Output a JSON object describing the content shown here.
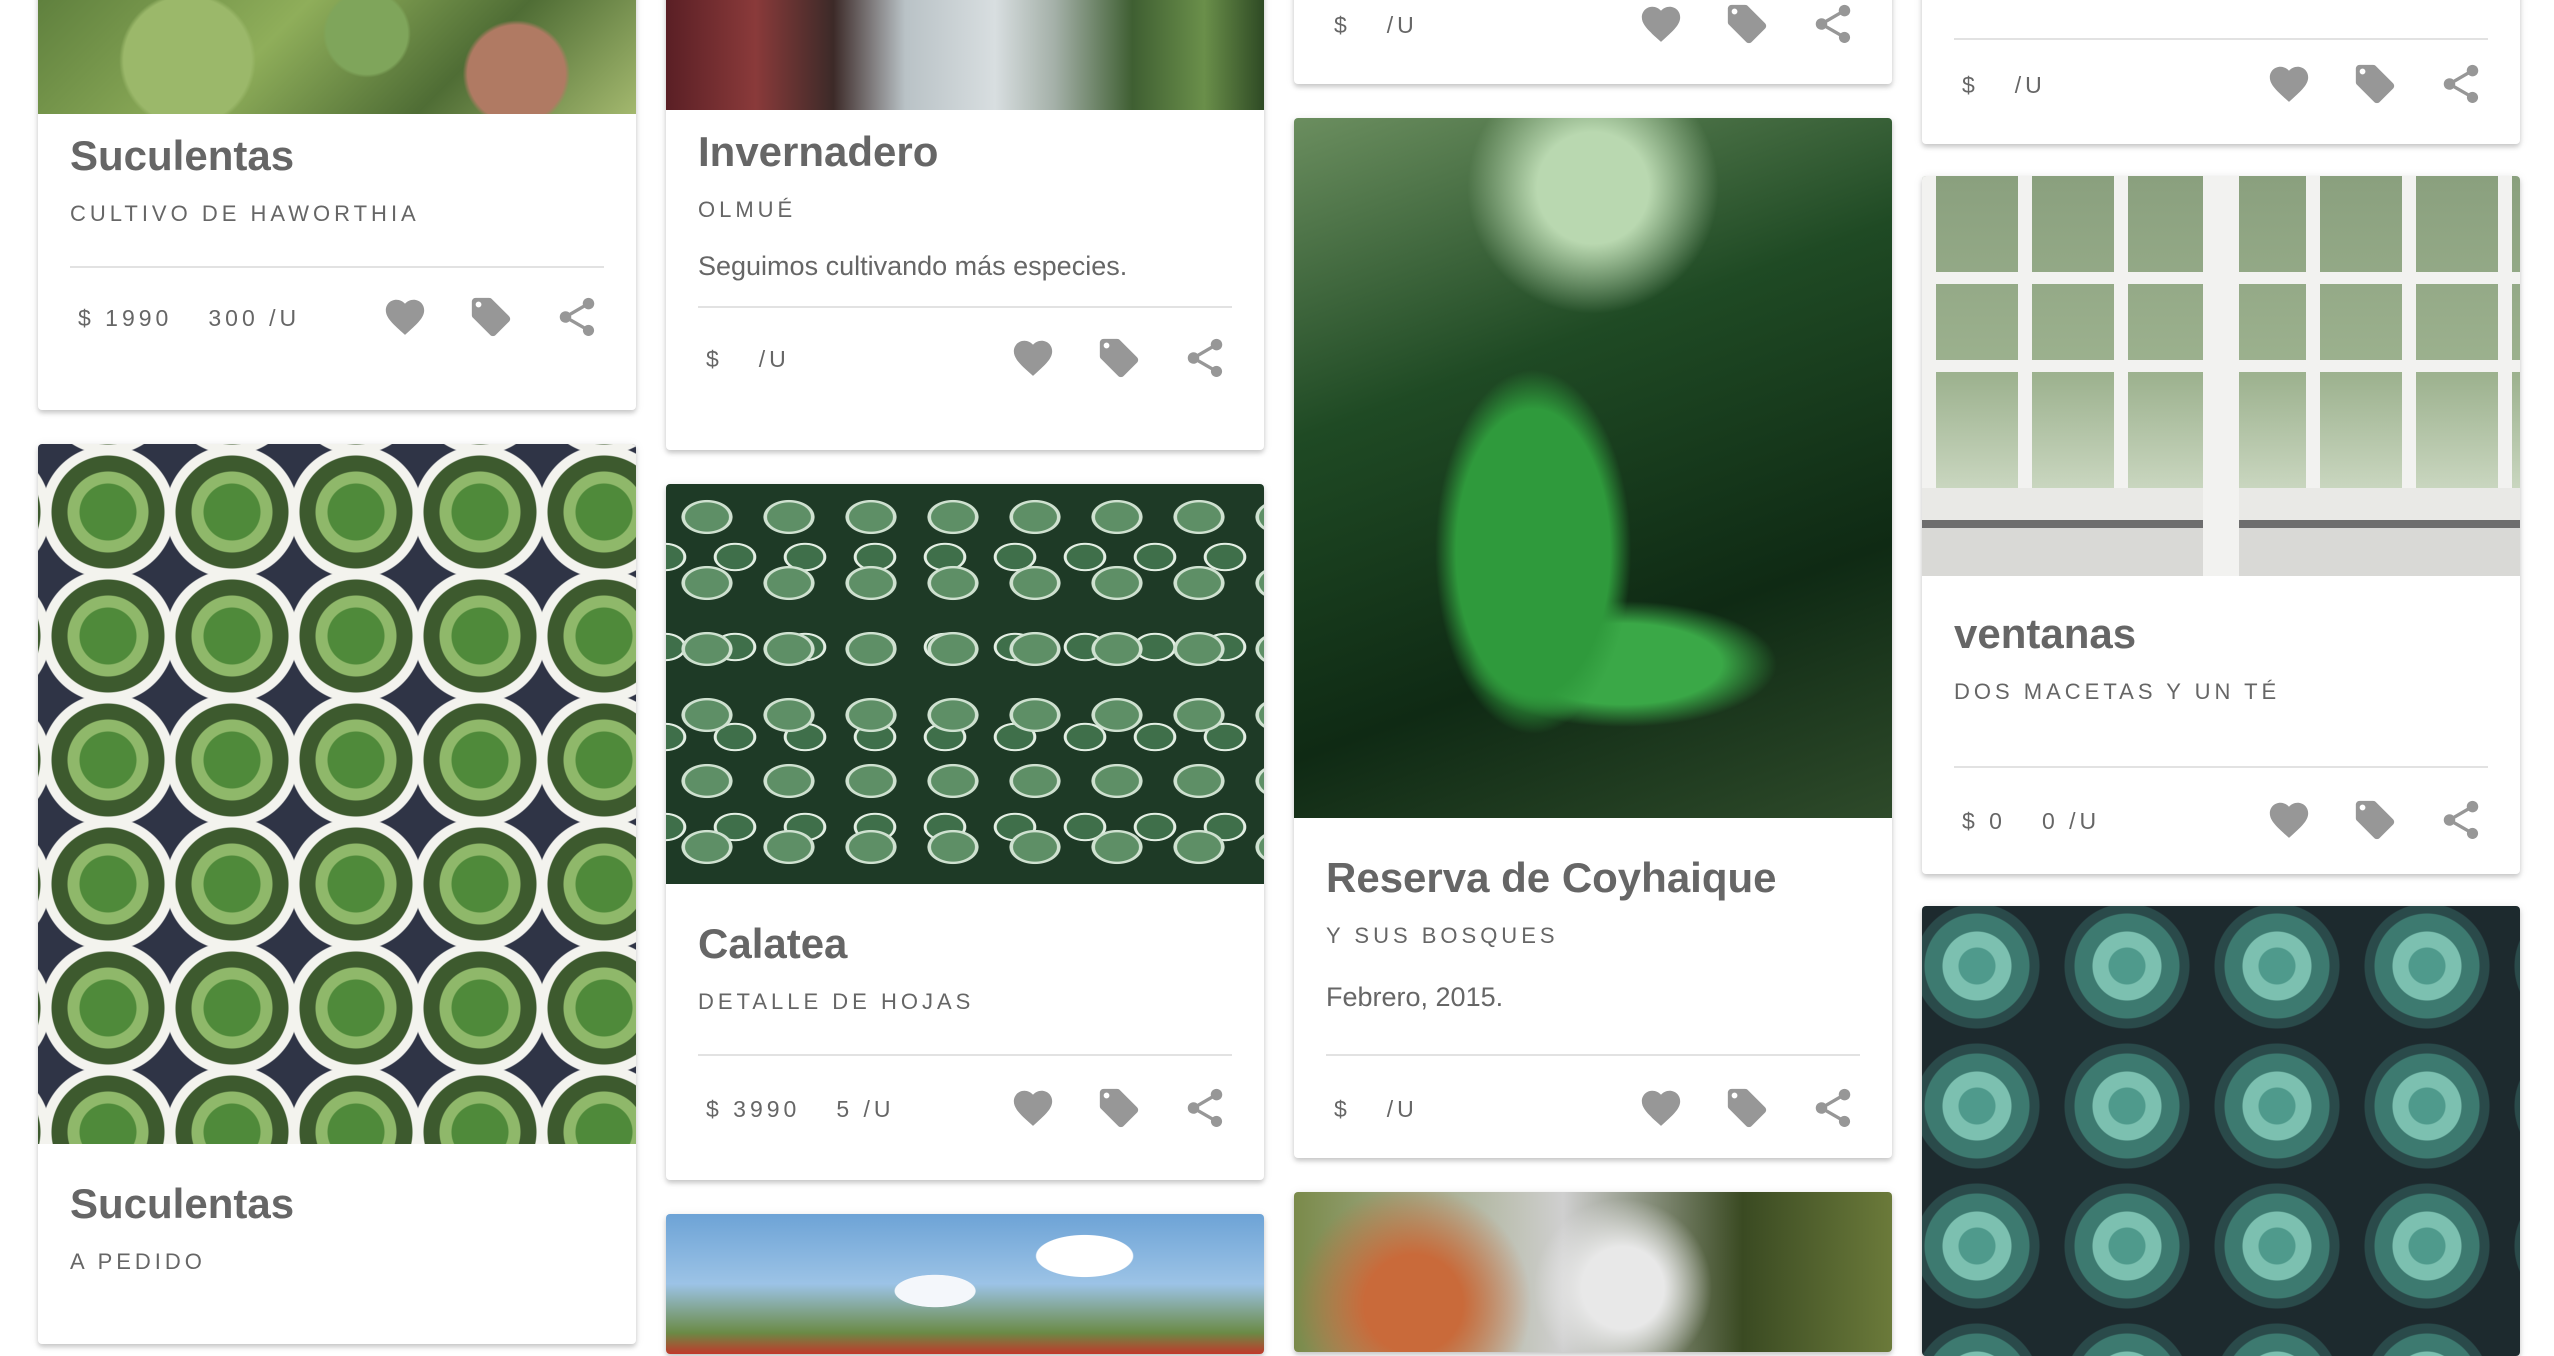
{
  "colors": {
    "icon": "#979797",
    "text": "#666666",
    "divider": "#e2e2e2"
  },
  "cards": [
    {
      "title": "",
      "subtitle": "",
      "desc": "",
      "price": "$",
      "unit": "/U"
    },
    {
      "title": "Suculentas",
      "subtitle": "CULTIVO DE HAWORTHIA",
      "desc": "",
      "price": "$ 1990",
      "unit": "300 /U"
    },
    {
      "title": "Suculentas",
      "subtitle": "A PEDIDO",
      "desc": "",
      "price": "",
      "unit": ""
    },
    {
      "title": "Invernadero",
      "subtitle": "OLMUÉ",
      "desc": "Seguimos cultivando más especies.",
      "price": "$",
      "unit": "/U"
    },
    {
      "title": "Calatea",
      "subtitle": "DETALLE DE HOJAS",
      "desc": "",
      "price": "$ 3990",
      "unit": "5 /U"
    },
    {
      "title": "",
      "subtitle": "",
      "desc": "",
      "price": "$",
      "unit": "/U"
    },
    {
      "title": "Reserva de Coyhaique",
      "subtitle": "Y SUS BOSQUES",
      "desc": "Febrero, 2015.",
      "price": "$",
      "unit": "/U"
    },
    {
      "title": "ventanas",
      "subtitle": "DOS MACETAS Y UN TÉ",
      "desc": "",
      "price": "$ 0",
      "unit": "0 /U"
    }
  ],
  "icons": {
    "favorite": "heart-icon",
    "tag": "tag-icon",
    "share": "share-icon"
  }
}
